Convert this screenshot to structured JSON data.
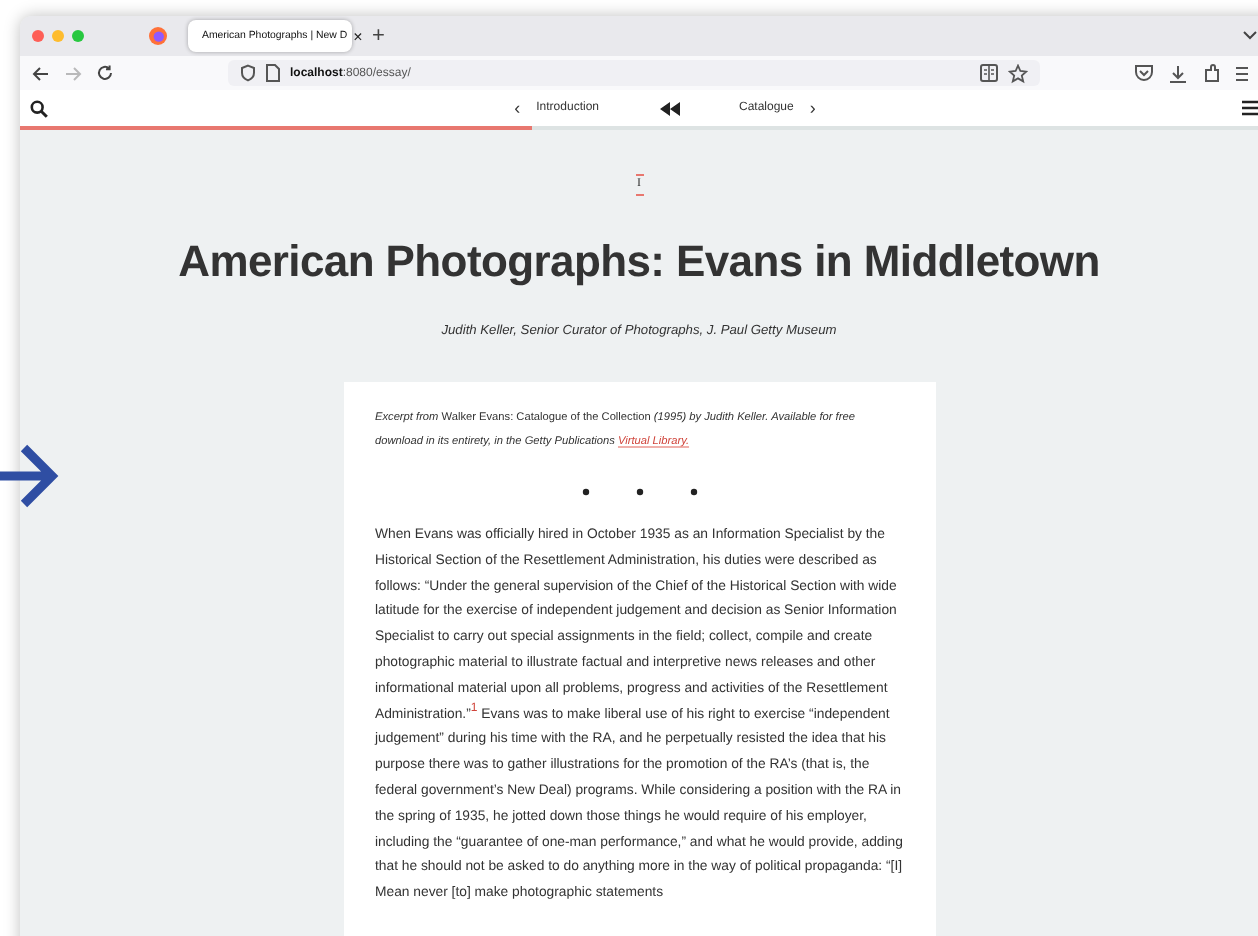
{
  "browser": {
    "tab": {
      "title": "American Photographs | New D",
      "close": "×"
    },
    "new_tab": "+",
    "forward": {
      "disabled": true
    },
    "address": {
      "host": "localhost",
      "path": ":8080/essay/"
    }
  },
  "site_nav": {
    "prev": {
      "arrow": "‹",
      "label": "Introduction"
    },
    "next": {
      "label": "Catalogue",
      "arrow": "›"
    },
    "progress": {
      "level": 0.4
    }
  },
  "page": {
    "marker": "I",
    "title": "American Photographs: Evans in Middletown",
    "byline": "Judith Keller, Senior Curator of Photographs, J. Paul Getty Museum",
    "excerpt": {
      "text": "*Excerpt from* Walker Evans: Catalogue of the Collection *(1995) by Judith Keller. Available for free download in its entirety, in the Getty Publications*",
      "link": "Virtual Library."
    },
    "body": "When Evans was officially hired in October 1935 as an Information Specialist by the Historical Section of the Resettlement Administration, his duties were described as follows: “Under the general supervision of the Chief of the Historical Section with wide latitude for the exercise of independent judgement and decision as Senior Information Specialist to carry out special assignments in the field; collect, compile and create photographic material to illustrate factual and interpretive news releases and other informational material upon all problems, progress and activities of the Resettlement Administration.”$^{1}$ Evans was to make liberal use of his right to exercise “independent judgement” during his time with the RA, and he perpetually resisted the idea that his purpose there was to gather illustrations for the promotion of the RA’s (that is, the federal government’s New Deal) programs. While considering a position with the RA in the spring of 1935, he jotted down those things he would require of his employer, including the “guarantee of one-man performance,” and what he would provide, adding that he should not be asked to do anything more in the way of political propaganda: “[I] Mean never [to] make photographic statements"
  }
}
